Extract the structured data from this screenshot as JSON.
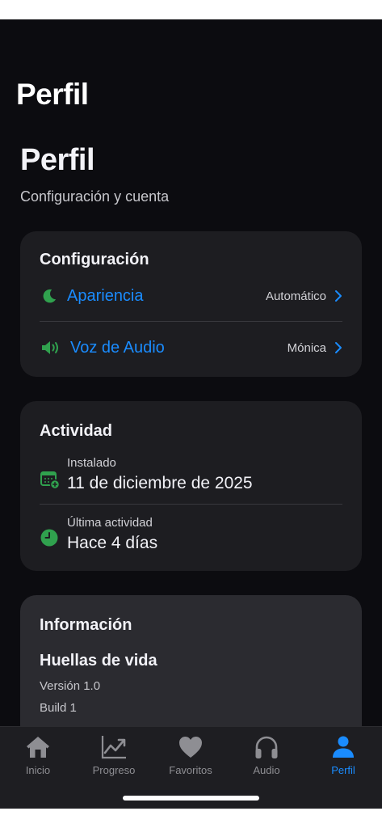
{
  "nav": {
    "title": "Perfil"
  },
  "header": {
    "title": "Perfil",
    "subtitle": "Configuración y cuenta"
  },
  "configuracion": {
    "heading": "Configuración",
    "appearance": {
      "label": "Apariencia",
      "value": "Automático",
      "icon": "moon-icon"
    },
    "voice": {
      "label": "Voz de Audio",
      "value": "Mónica",
      "icon": "speaker-icon"
    }
  },
  "actividad": {
    "heading": "Actividad",
    "installed": {
      "label": "Instalado",
      "value": "11 de diciembre de 2025",
      "icon": "calendar-add-icon"
    },
    "last_activity": {
      "label": "Última actividad",
      "value": "Hace 4 días",
      "icon": "clock-icon"
    }
  },
  "informacion": {
    "heading": "Información",
    "app_name": "Huellas de vida",
    "version": "Versión 1.0",
    "build": "Build 1"
  },
  "tabbar": {
    "tabs": [
      {
        "label": "Inicio",
        "icon": "house-icon"
      },
      {
        "label": "Progreso",
        "icon": "chart-line-icon"
      },
      {
        "label": "Favoritos",
        "icon": "heart-icon"
      },
      {
        "label": "Audio",
        "icon": "headphones-icon"
      },
      {
        "label": "Perfil",
        "icon": "person-icon"
      }
    ],
    "active_tab": "Perfil"
  },
  "colors": {
    "accent": "#1a8cff",
    "icon_green": "#30a14e",
    "background": "#0c0c10",
    "card": "#1d1d21",
    "tab_inactive": "#8e8e93"
  }
}
